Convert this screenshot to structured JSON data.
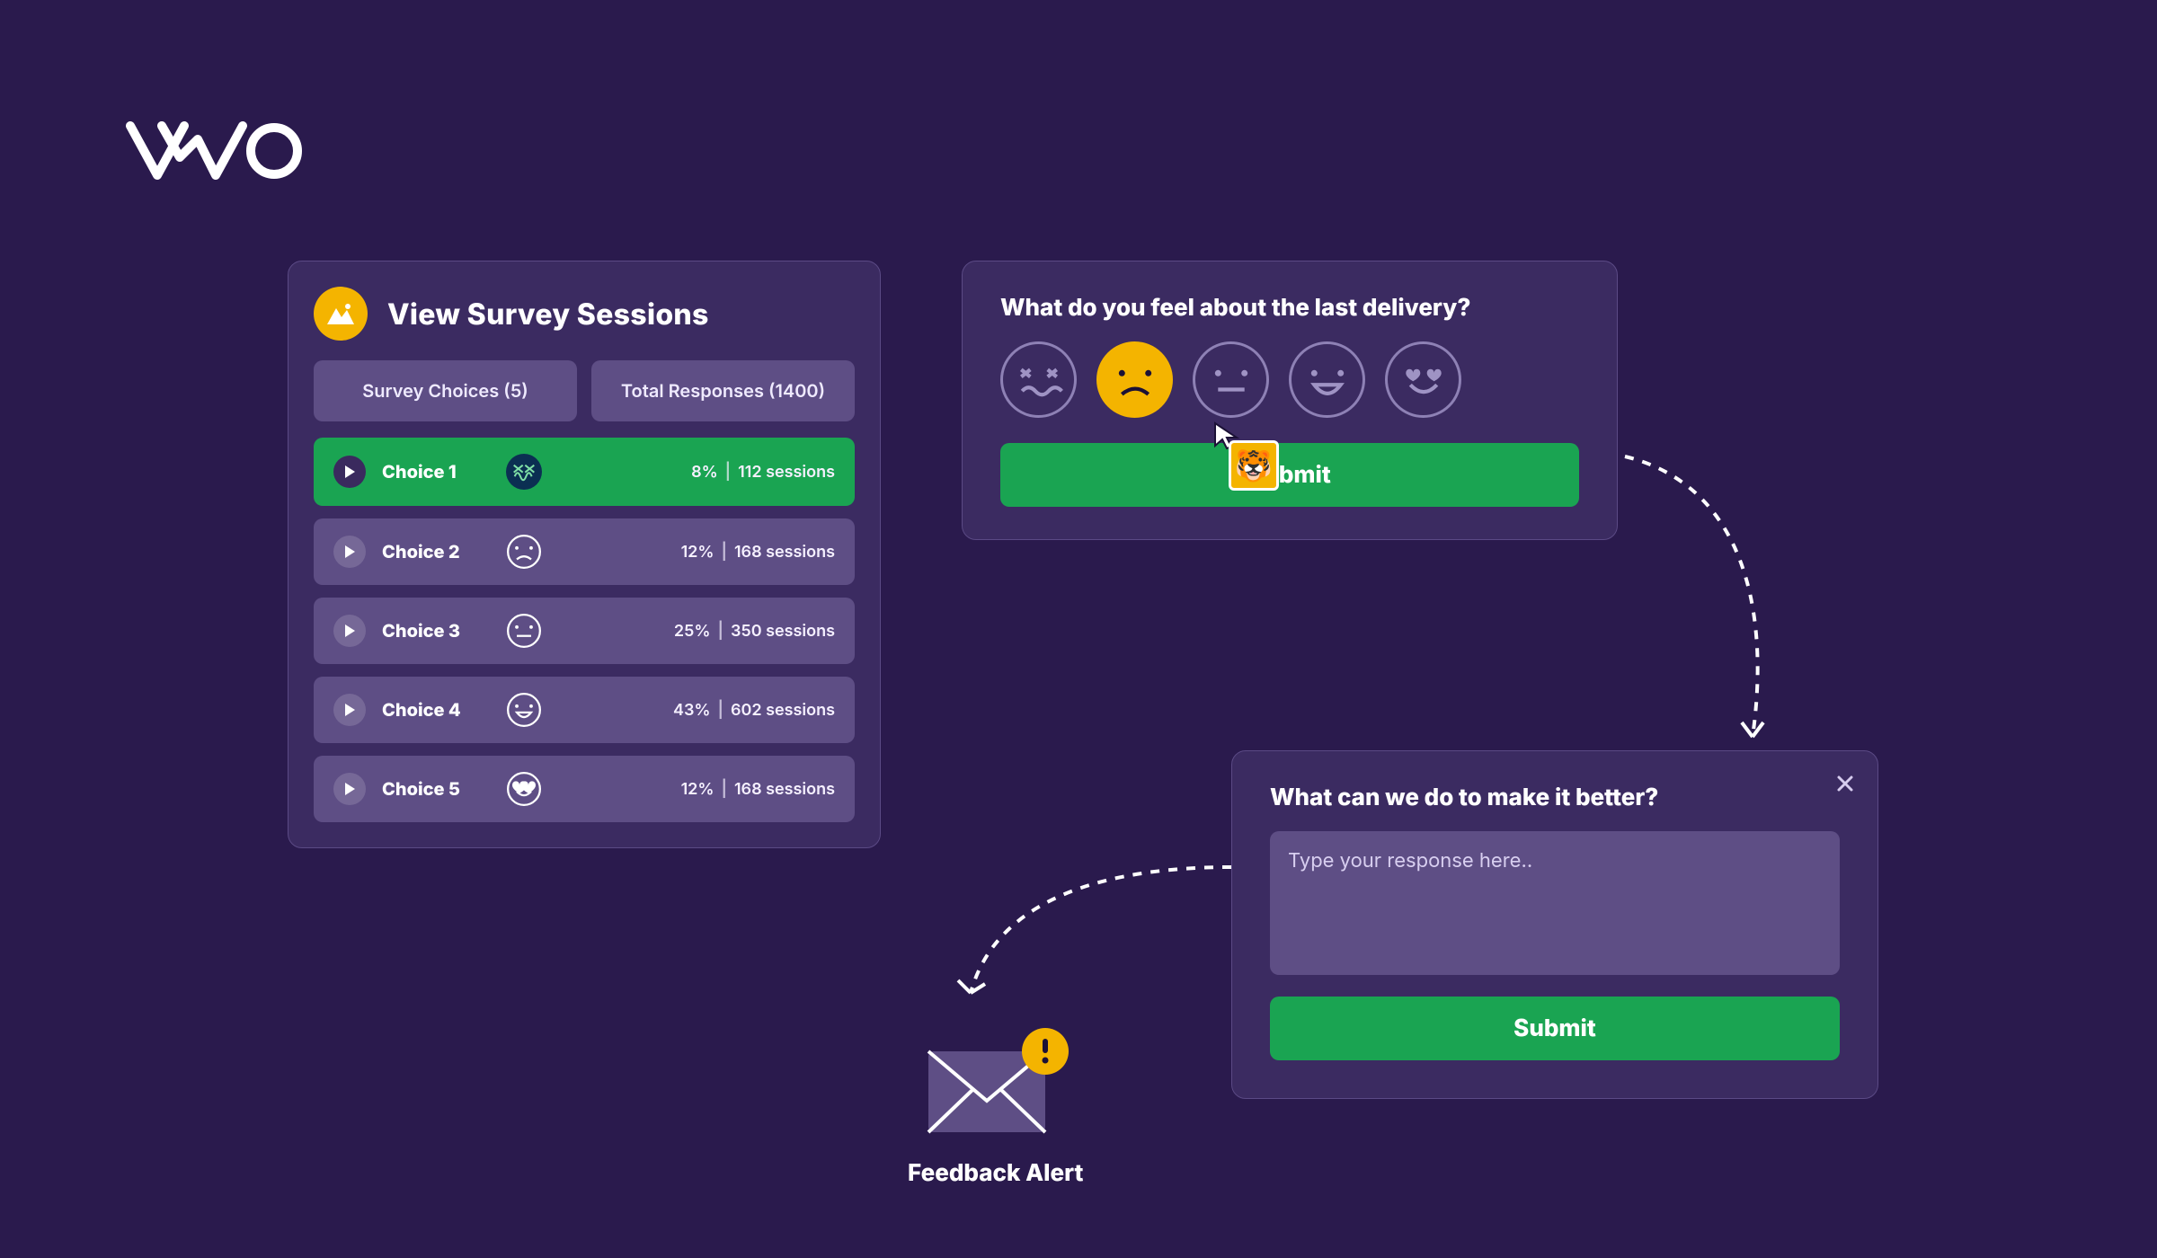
{
  "logo_alt": "VWO",
  "sessions": {
    "title": "View Survey Sessions",
    "tabs": {
      "choices": "Survey Choices (5)",
      "responses": "Total Responses (1400)"
    },
    "rows": [
      {
        "label": "Choice 1",
        "face": "sick",
        "percent": "8%",
        "sessions": "112 sessions",
        "active": true
      },
      {
        "label": "Choice 2",
        "face": "sad",
        "percent": "12%",
        "sessions": "168 sessions",
        "active": false
      },
      {
        "label": "Choice 3",
        "face": "neutral",
        "percent": "25%",
        "sessions": "350 sessions",
        "active": false
      },
      {
        "label": "Choice 4",
        "face": "happy",
        "percent": "43%",
        "sessions": "602 sessions",
        "active": false
      },
      {
        "label": "Choice 5",
        "face": "love",
        "percent": "12%",
        "sessions": "168 sessions",
        "active": false
      }
    ]
  },
  "rating": {
    "question": "What do you feel about the last delivery?",
    "selected_index": 1,
    "faces": [
      "sick",
      "sad",
      "neutral",
      "happy",
      "love"
    ],
    "submit": "Submit"
  },
  "followup": {
    "question": "What can we do to make it better?",
    "placeholder": "Type your response here..",
    "submit": "Submit"
  },
  "feedback_alert_label": "Feedback Alert",
  "colors": {
    "bg": "#2a1a4d",
    "panel": "#3b2b61",
    "row": "#5e4e85",
    "active_row": "#1aa452",
    "green": "#1aa452",
    "yellow": "#f4b400"
  }
}
